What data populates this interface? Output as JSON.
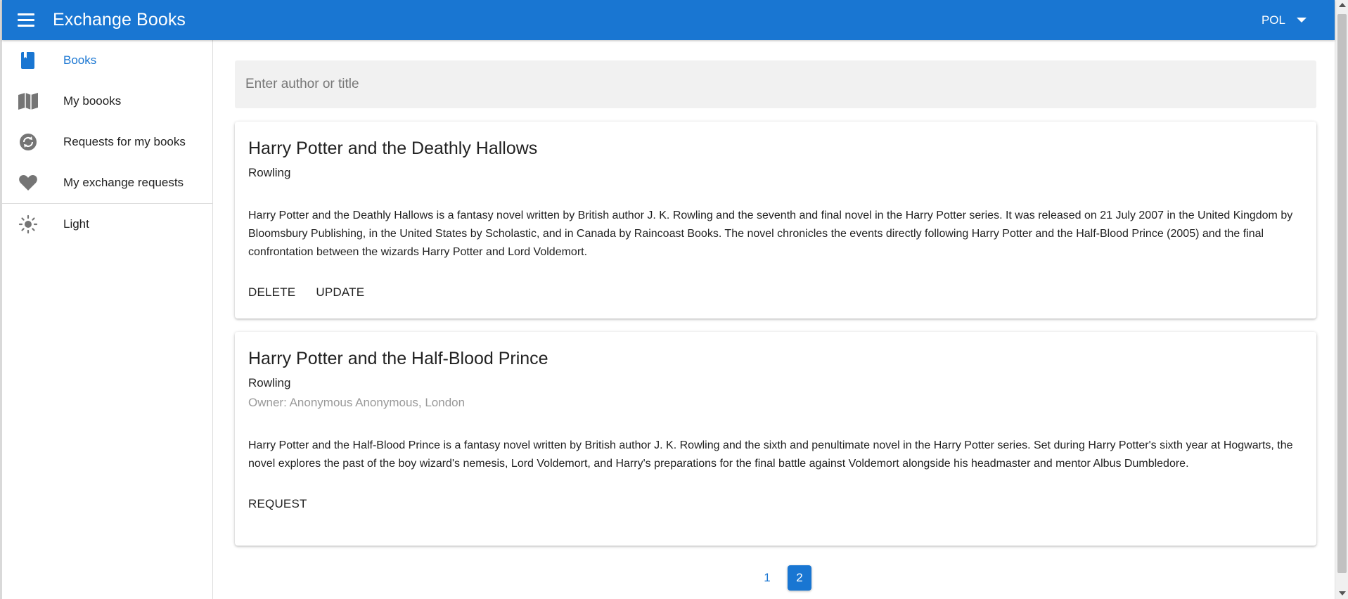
{
  "app": {
    "title": "Exchange Books",
    "language": "POL",
    "accent_color": "#1976d2"
  },
  "sidebar": {
    "items": [
      {
        "label": "Books",
        "icon": "book-icon",
        "active": true
      },
      {
        "label": "My boooks",
        "icon": "open-book-icon",
        "active": false
      },
      {
        "label": "Requests for my books",
        "icon": "sync-icon",
        "active": false
      },
      {
        "label": "My exchange requests",
        "icon": "heart-icon",
        "active": false
      }
    ],
    "theme_toggle": {
      "label": "Light",
      "icon": "sun-icon"
    }
  },
  "search": {
    "placeholder": "Enter author or title",
    "value": ""
  },
  "books": [
    {
      "title": "Harry Potter and the Deathly Hallows",
      "author": "Rowling",
      "description": "Harry Potter and the Deathly Hallows is a fantasy novel written by British author J. K. Rowling and the seventh and final novel in the Harry Potter series. It was released on 21 July 2007 in the United Kingdom by Bloomsbury Publishing, in the United States by Scholastic, and in Canada by Raincoast Books. The novel chronicles the events directly following Harry Potter and the Half-Blood Prince (2005) and the final confrontation between the wizards Harry Potter and Lord Voldemort.",
      "actions": [
        "DELETE",
        "UPDATE"
      ]
    },
    {
      "title": "Harry Potter and the Half-Blood Prince",
      "author": "Rowling",
      "owner": "Owner: Anonymous Anonymous, London",
      "description": "Harry Potter and the Half-Blood Prince is a fantasy novel written by British author J. K. Rowling and the sixth and penultimate novel in the Harry Potter series. Set during Harry Potter's sixth year at Hogwarts, the novel explores the past of the boy wizard's nemesis, Lord Voldemort, and Harry's preparations for the final battle against Voldemort alongside his headmaster and mentor Albus Dumbledore.",
      "actions": [
        "REQUEST"
      ]
    }
  ],
  "pagination": {
    "pages": [
      "1",
      "2"
    ],
    "current": "2"
  }
}
